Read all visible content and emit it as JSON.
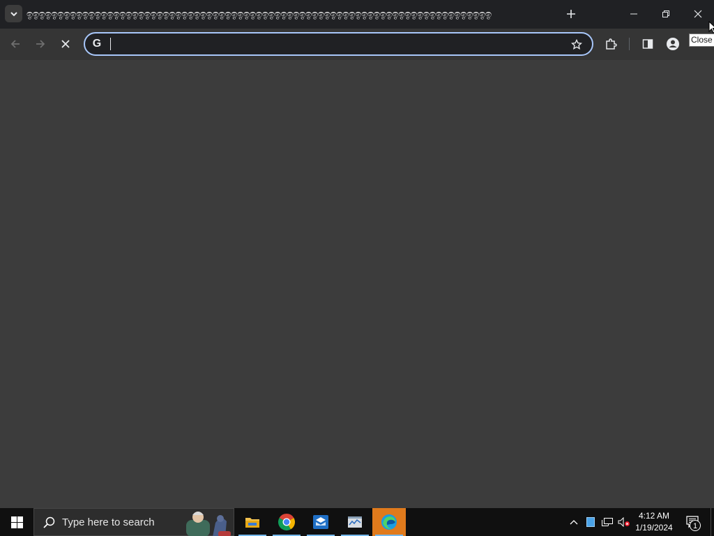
{
  "browser": {
    "tab": {
      "title": "ඉඉඉඉඉඉඉඉඉඉඉඉඉඉඉඉඉඉඉඉඉඉඉඉඉඉඉඉඉඉඉඉඉඉඉඉඉඉඉඉඉඉඉඉඉඉඉඉඉඉඉඉඉඉඉඉඉඉඉඉඉඉඉඉඉඉඉඉඉඉඉඉඉඉඉ",
      "search_icon": "chevron-down-icon",
      "new_tab_icon": "plus-icon"
    },
    "window_controls": {
      "minimize_icon": "minimize-icon",
      "restore_icon": "restore-icon",
      "close_icon": "close-icon",
      "close_tooltip": "Close"
    },
    "toolbar": {
      "back_icon": "back-arrow-icon",
      "forward_icon": "forward-arrow-icon",
      "stop_icon": "stop-loading-icon",
      "omnibox": {
        "value": "",
        "placeholder": "",
        "engine_icon": "google-g-icon",
        "engine_letter": "G",
        "bookmark_icon": "star-icon"
      },
      "extensions_icon": "puzzle-icon",
      "side_panel_icon": "side-panel-icon",
      "profile_icon": "profile-icon"
    }
  },
  "taskbar": {
    "search_placeholder": "Type here to search",
    "apps": [
      {
        "name": "File Explorer",
        "icon": "folder-icon",
        "running": true
      },
      {
        "name": "Google Chrome",
        "icon": "chrome-icon",
        "running": true
      },
      {
        "name": "Mail",
        "icon": "mail-icon",
        "running": true
      },
      {
        "name": "Task Manager",
        "icon": "task-manager-icon",
        "running": true
      },
      {
        "name": "Microsoft Edge",
        "icon": "edge-icon",
        "running": true,
        "active": true
      }
    ],
    "tray": {
      "clock_time": "4:12 AM",
      "clock_date": "1/19/2024",
      "notification_count": "1"
    }
  },
  "colors": {
    "titlebar": "#202124",
    "toolbar": "#353535",
    "page": "#3c3c3c",
    "omnibox_focus": "#a8c7fa",
    "taskbar": "#101010",
    "active_task": "#e07a1c"
  }
}
